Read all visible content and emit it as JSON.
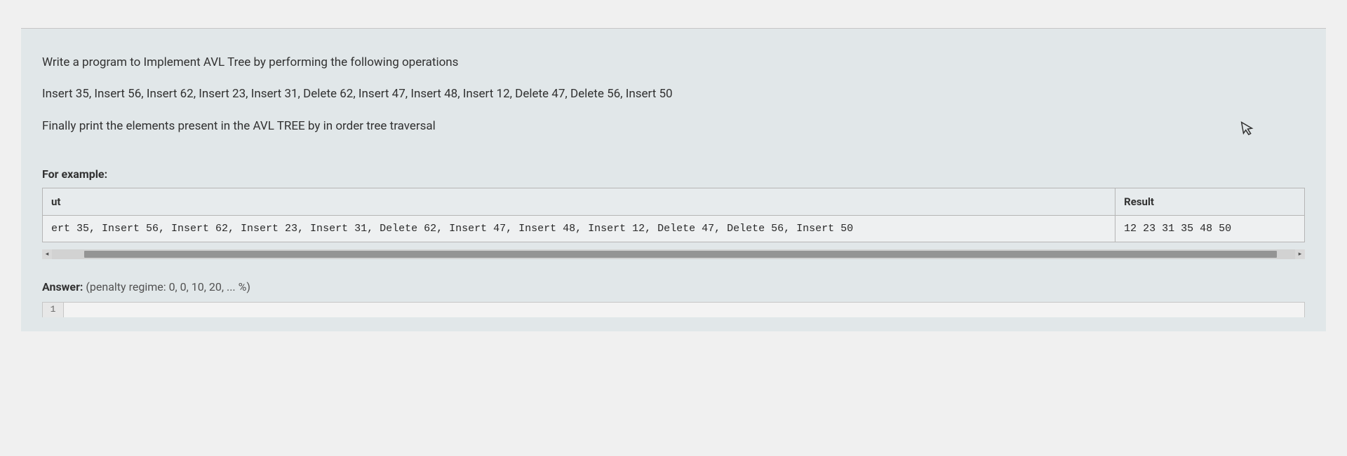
{
  "question": {
    "line1": "Write a program to Implement AVL Tree by performing the following operations",
    "line2": "Insert 35, Insert 56,  Insert 62, Insert 23,  Insert 31, Delete 62, Insert 47, Insert 48, Insert 12, Delete 47,    Delete 56, Insert 50",
    "line3": "Finally print the elements present in the AVL TREE by in order tree traversal"
  },
  "example": {
    "label": "For example:",
    "headers": {
      "input": "ut",
      "result": "Result"
    },
    "row": {
      "input": "ert 35, Insert 56,  Insert 62, Insert 23,  Insert 31, Delete 62, Insert 47, Insert 48, Insert 12, Delete 47,  Delete 56, Insert 50",
      "result": "12 23 31 35 48 50"
    }
  },
  "answer": {
    "label": "Answer:",
    "regime": "(penalty regime: 0, 0, 10, 20, ... %)"
  },
  "editor": {
    "line_number": "1"
  }
}
